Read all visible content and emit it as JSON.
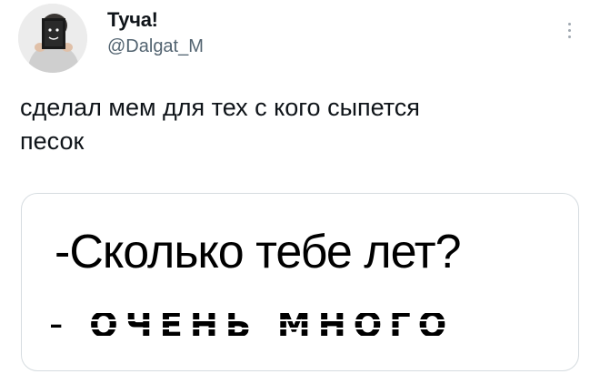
{
  "author": {
    "display_name": "Туча!",
    "handle": "@Dalgat_M",
    "avatar_icon": "person-holding-smiley-sign-avatar"
  },
  "more_icon": "more-vertical-icon",
  "tweet": {
    "text": "сделал мем для тех с кого сыпется\nпесок"
  },
  "media": {
    "question": "-Сколько тебе лет?",
    "answer": "- ОЧЕНЬ МНОГО"
  },
  "colors": {
    "text": "#0f1419",
    "secondary_text": "#536471",
    "card_border": "#d6dce0"
  }
}
